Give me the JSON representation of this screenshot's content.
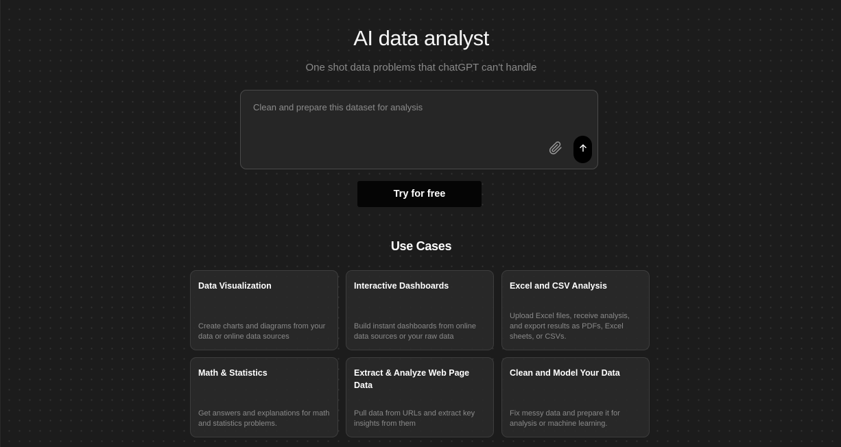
{
  "hero": {
    "title": "AI data analyst",
    "subtitle": "One shot data problems that chatGPT can't handle"
  },
  "prompt": {
    "placeholder": "Clean and prepare this dataset for analysis",
    "value": "",
    "attach_icon": "paperclip-icon",
    "send_icon": "arrow-up-icon"
  },
  "cta": {
    "label": "Try for free"
  },
  "use_cases": {
    "title": "Use Cases",
    "cards": [
      {
        "title": "Data Visualization",
        "description": "Create charts and diagrams from your data or online data sources"
      },
      {
        "title": "Interactive Dashboards",
        "description": "Build instant dashboards from online data sources or your raw data"
      },
      {
        "title": "Excel and CSV Analysis",
        "description": "Upload Excel files, receive analysis, and export results as PDFs, Excel sheets, or CSVs."
      },
      {
        "title": "Math & Statistics",
        "description": "Get answers and explanations for math and statistics problems."
      },
      {
        "title": "Extract & Analyze Web Page Data",
        "description": "Pull data from URLs and extract key insights from them"
      },
      {
        "title": "Clean and Model Your Data",
        "description": "Fix messy data and prepare it for analysis or machine learning."
      }
    ]
  },
  "colors": {
    "background": "#1c1c1c",
    "card": "#2a2a2a",
    "button": "#050505",
    "muted_text": "#8a8a8a"
  }
}
